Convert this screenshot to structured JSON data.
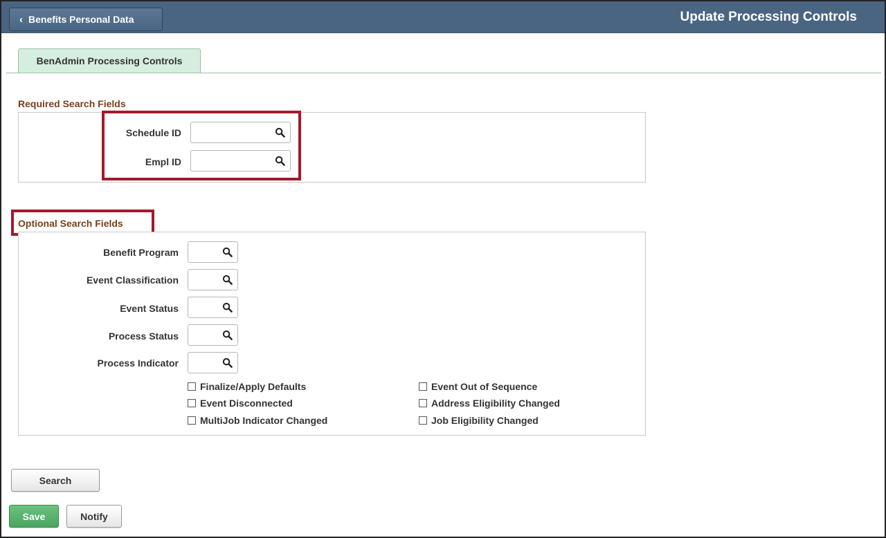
{
  "header": {
    "back_label": "Benefits Personal Data",
    "title": "Update Processing Controls"
  },
  "tab": {
    "label": "BenAdmin Processing Controls"
  },
  "required": {
    "title": "Required Search Fields",
    "fields": [
      {
        "label": "Schedule ID",
        "value": ""
      },
      {
        "label": "Empl ID",
        "value": ""
      }
    ]
  },
  "optional": {
    "title": "Optional Search Fields",
    "fields": [
      {
        "label": "Benefit Program",
        "value": ""
      },
      {
        "label": "Event Classification",
        "value": ""
      },
      {
        "label": "Event Status",
        "value": ""
      },
      {
        "label": "Process Status",
        "value": ""
      },
      {
        "label": "Process Indicator",
        "value": ""
      }
    ],
    "checkboxes": [
      {
        "label": "Finalize/Apply Defaults",
        "checked": false
      },
      {
        "label": "Event Out of Sequence",
        "checked": false
      },
      {
        "label": "Event Disconnected",
        "checked": false
      },
      {
        "label": "Address Eligibility Changed",
        "checked": false
      },
      {
        "label": "MultiJob Indicator Changed",
        "checked": false
      },
      {
        "label": "Job Eligibility Changed",
        "checked": false
      }
    ]
  },
  "buttons": {
    "search": "Search",
    "save": "Save",
    "notify": "Notify"
  },
  "colors": {
    "header_bg": "#4a6582",
    "tab_bg": "#d6eee0",
    "section_title": "#7a3e1a",
    "highlight": "#a3192b",
    "save_green": "#4aa55f"
  }
}
